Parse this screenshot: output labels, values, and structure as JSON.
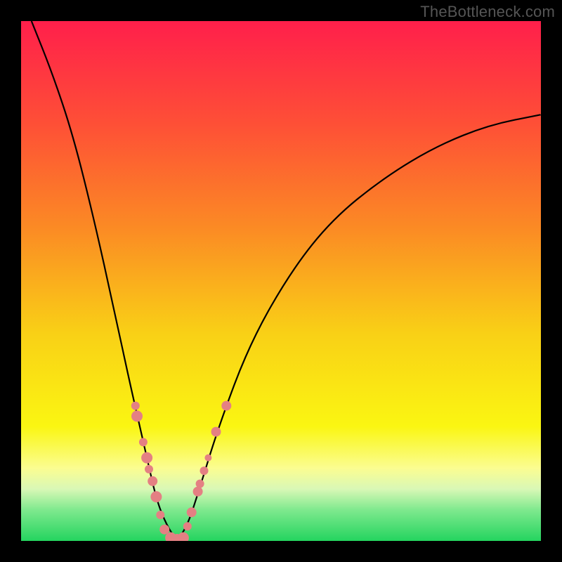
{
  "watermark": "TheBottleneck.com",
  "colors": {
    "frame": "#000000",
    "curve_stroke": "#000000",
    "dot_fill": "#e48083",
    "gradient_stops": [
      {
        "offset": 0.0,
        "color": "#ff1f4b"
      },
      {
        "offset": 0.2,
        "color": "#fe5036"
      },
      {
        "offset": 0.4,
        "color": "#fb8b24"
      },
      {
        "offset": 0.6,
        "color": "#f9d016"
      },
      {
        "offset": 0.78,
        "color": "#faf612"
      },
      {
        "offset": 0.86,
        "color": "#fbfd91"
      },
      {
        "offset": 0.9,
        "color": "#d9f8b6"
      },
      {
        "offset": 0.94,
        "color": "#7fe98e"
      },
      {
        "offset": 1.0,
        "color": "#24d45f"
      }
    ]
  },
  "chart_data": {
    "type": "line",
    "title": "",
    "xlabel": "",
    "ylabel": "",
    "xlim": [
      0,
      100
    ],
    "ylim": [
      0,
      100
    ],
    "legend": false,
    "grid": false,
    "curve_points": [
      {
        "x": 2,
        "y": 100
      },
      {
        "x": 6,
        "y": 90
      },
      {
        "x": 10,
        "y": 78
      },
      {
        "x": 14,
        "y": 62
      },
      {
        "x": 18,
        "y": 44
      },
      {
        "x": 21,
        "y": 30
      },
      {
        "x": 24,
        "y": 17
      },
      {
        "x": 26,
        "y": 8
      },
      {
        "x": 28,
        "y": 3
      },
      {
        "x": 30,
        "y": 0
      },
      {
        "x": 32,
        "y": 3
      },
      {
        "x": 34,
        "y": 9
      },
      {
        "x": 38,
        "y": 22
      },
      {
        "x": 44,
        "y": 38
      },
      {
        "x": 52,
        "y": 52
      },
      {
        "x": 60,
        "y": 62
      },
      {
        "x": 70,
        "y": 70
      },
      {
        "x": 80,
        "y": 76
      },
      {
        "x": 90,
        "y": 80
      },
      {
        "x": 100,
        "y": 82
      }
    ],
    "data_points": [
      {
        "x": 22.0,
        "y": 26.0,
        "r": 6
      },
      {
        "x": 22.3,
        "y": 24.0,
        "r": 8
      },
      {
        "x": 23.5,
        "y": 19.0,
        "r": 6
      },
      {
        "x": 24.2,
        "y": 16.0,
        "r": 8
      },
      {
        "x": 24.6,
        "y": 13.8,
        "r": 6
      },
      {
        "x": 25.3,
        "y": 11.5,
        "r": 7
      },
      {
        "x": 26.0,
        "y": 8.5,
        "r": 8
      },
      {
        "x": 26.8,
        "y": 5.0,
        "r": 6
      },
      {
        "x": 27.6,
        "y": 2.2,
        "r": 7
      },
      {
        "x": 28.8,
        "y": 0.6,
        "r": 8
      },
      {
        "x": 30.0,
        "y": 0.4,
        "r": 7
      },
      {
        "x": 31.2,
        "y": 0.6,
        "r": 8
      },
      {
        "x": 32.0,
        "y": 2.8,
        "r": 6
      },
      {
        "x": 32.8,
        "y": 5.5,
        "r": 7
      },
      {
        "x": 34.0,
        "y": 9.5,
        "r": 7
      },
      {
        "x": 34.4,
        "y": 11.0,
        "r": 6
      },
      {
        "x": 35.2,
        "y": 13.5,
        "r": 6
      },
      {
        "x": 36.0,
        "y": 16.0,
        "r": 5
      },
      {
        "x": 37.5,
        "y": 21.0,
        "r": 7
      },
      {
        "x": 39.5,
        "y": 26.0,
        "r": 7
      }
    ]
  }
}
